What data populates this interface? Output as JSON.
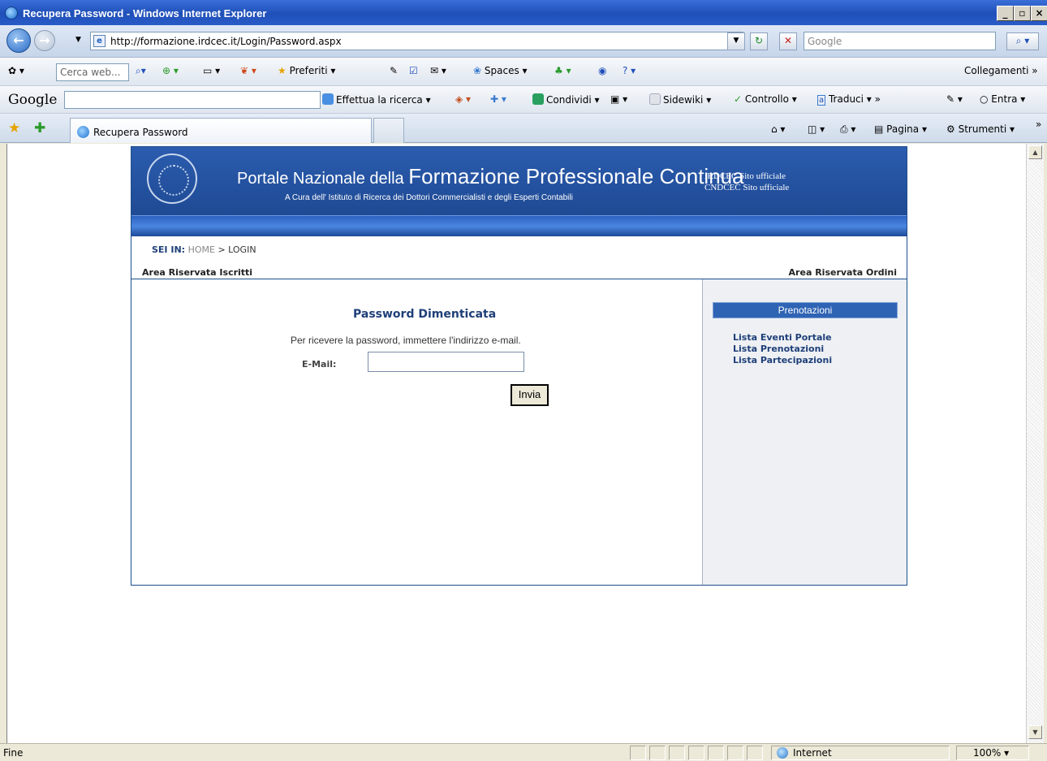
{
  "window": {
    "title": "Recupera Password - Windows Internet Explorer"
  },
  "address": {
    "url": "http://formazione.irdcec.it/Login/Password.aspx",
    "search_placeholder": "Google"
  },
  "toolbar1": {
    "search_placeholder": "Cerca web...",
    "favorites": "Preferiti",
    "spaces": "Spaces",
    "links": "Collegamenti"
  },
  "toolbar2": {
    "google": "Google",
    "search": "Effettua la ricerca",
    "share": "Condividi",
    "sidewiki": "Sidewiki",
    "spellcheck": "Controllo",
    "translate": "Traduci",
    "signin": "Entra"
  },
  "tabs": {
    "active_label": "Recupera Password",
    "page_menu": "Pagina",
    "tools_menu": "Strumenti"
  },
  "site": {
    "title_small": "Portale Nazionale della",
    "title_big": "Formazione Professionale Continua",
    "subtitle": "A Cura dell' Istituto di Ricerca dei Dottori Commercialisti e degli Esperti Contabili",
    "link1": "IRDCEC Sito ufficiale",
    "link2": "CNDCEC Sito ufficiale",
    "breadcrumb": {
      "label": "SEI IN:",
      "home": "HOME",
      "sep": ">",
      "current": "LOGIN"
    },
    "area_left": "Area Riservata Iscritti",
    "area_right": "Area Riservata Ordini",
    "form": {
      "title": "Password Dimenticata",
      "info": "Per ricevere la password, immettere l'indirizzo e-mail.",
      "email_label": "E-Mail:",
      "email_value": "",
      "submit": "Invia"
    },
    "sidebar": {
      "heading": "Prenotazioni",
      "links": [
        "Lista Eventi Portale",
        "Lista Prenotazioni",
        "Lista Partecipazioni"
      ]
    }
  },
  "status": {
    "text": "Fine",
    "zone": "Internet",
    "zoom": "100%"
  }
}
